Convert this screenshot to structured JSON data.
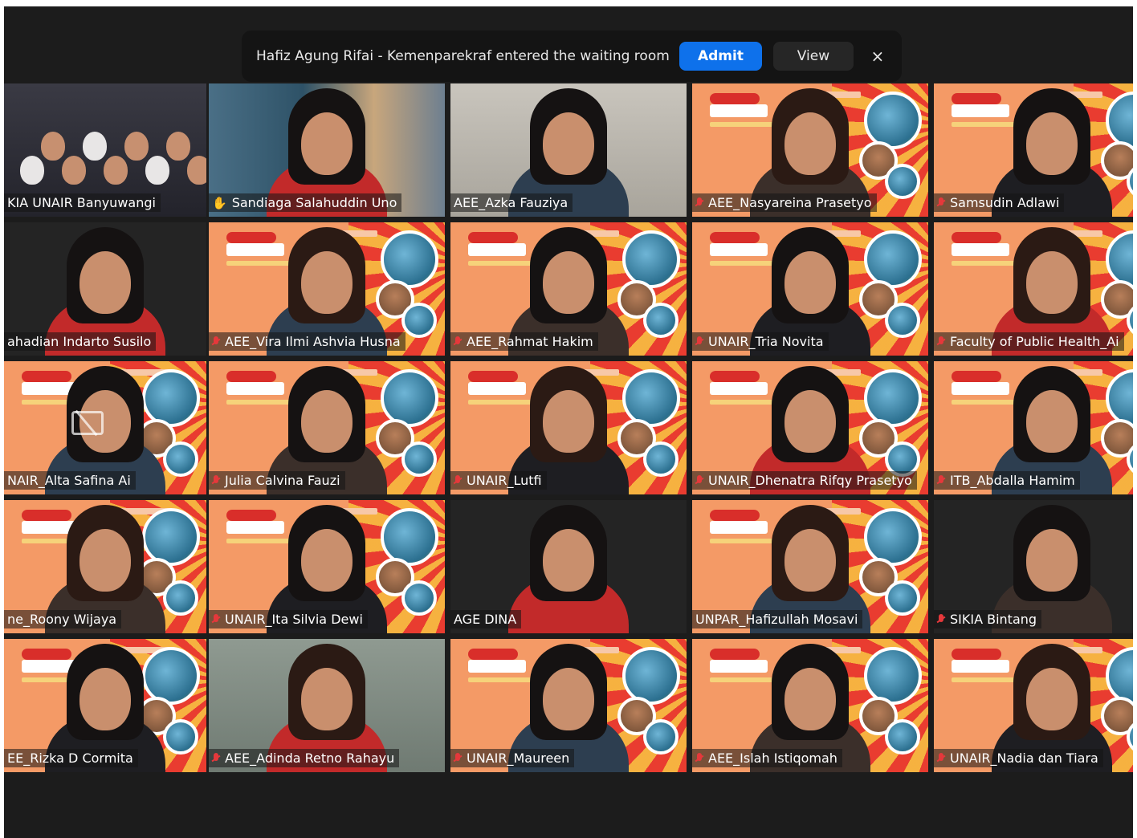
{
  "notification": {
    "message": "Hafiz Agung Rifai - Kemenparekraf entered the waiting room",
    "admit_label": "Admit",
    "view_label": "View",
    "close_label": "×"
  },
  "participants": [
    {
      "name": "KIA UNAIR Banyuwangi",
      "bg": "group",
      "icon": "none"
    },
    {
      "name": "Sandiaga Salahuddin Uno",
      "bg": "g20",
      "icon": "hand"
    },
    {
      "name": "AEE_Azka Fauziya",
      "bg": "wall",
      "icon": "none",
      "active": true
    },
    {
      "name": "AEE_Nasyareina Prasetyo",
      "bg": "webinar",
      "icon": "mic-muted"
    },
    {
      "name": "Samsudin Adlawi",
      "bg": "webinar",
      "icon": "mic-muted"
    },
    {
      "name": "ahadian Indarto Susilo",
      "bg": "dark",
      "icon": "none"
    },
    {
      "name": "AEE_Vira Ilmi Ashvia Husna",
      "bg": "webinar",
      "icon": "mic-muted"
    },
    {
      "name": "AEE_Rahmat Hakim",
      "bg": "webinar",
      "icon": "mic-muted"
    },
    {
      "name": "UNAIR_Tria Novita",
      "bg": "webinar",
      "icon": "mic-muted"
    },
    {
      "name": "Faculty of Public Health_Ai",
      "bg": "webinar",
      "icon": "mic-muted"
    },
    {
      "name": "NAIR_Alta Safina Ai",
      "bg": "webinar",
      "icon": "none"
    },
    {
      "name": "Julia Calvina Fauzi",
      "bg": "webinar",
      "icon": "mic-muted"
    },
    {
      "name": "UNAIR_Lutfi",
      "bg": "webinar",
      "icon": "mic-muted"
    },
    {
      "name": "UNAIR_Dhenatra Rifqy Prasetyo",
      "bg": "webinar",
      "icon": "mic-muted"
    },
    {
      "name": "ITB_Abdalla Hamim",
      "bg": "webinar",
      "icon": "mic-muted"
    },
    {
      "name": "ne_Roony Wijaya",
      "bg": "webinar",
      "icon": "none"
    },
    {
      "name": "UNAIR_Ita Silvia Dewi",
      "bg": "webinar",
      "icon": "mic-muted"
    },
    {
      "name": "AGE DINA",
      "bg": "dark",
      "icon": "none"
    },
    {
      "name": "UNPAR_Hafizullah Mosavi",
      "bg": "webinar",
      "icon": "none"
    },
    {
      "name": "SIKIA Bintang",
      "bg": "dark",
      "icon": "mic-muted"
    },
    {
      "name": "EE_Rizka D Cormita",
      "bg": "webinar",
      "icon": "none"
    },
    {
      "name": "AEE_Adinda Retno Rahayu",
      "bg": "gray",
      "icon": "mic-muted"
    },
    {
      "name": "UNAIR_Maureen",
      "bg": "webinar",
      "icon": "mic-muted"
    },
    {
      "name": "AEE_Islah Istiqomah",
      "bg": "webinar",
      "icon": "mic-muted"
    },
    {
      "name": "UNAIR_Nadia dan Tiara",
      "bg": "webinar",
      "icon": "mic-muted"
    }
  ],
  "colors": {
    "background": "#1c1c1c",
    "admit_button": "#0e71eb",
    "active_speaker_border": "#c8e86a",
    "muted_mic": "#e5383b",
    "webinar_background": "#f49a66"
  }
}
